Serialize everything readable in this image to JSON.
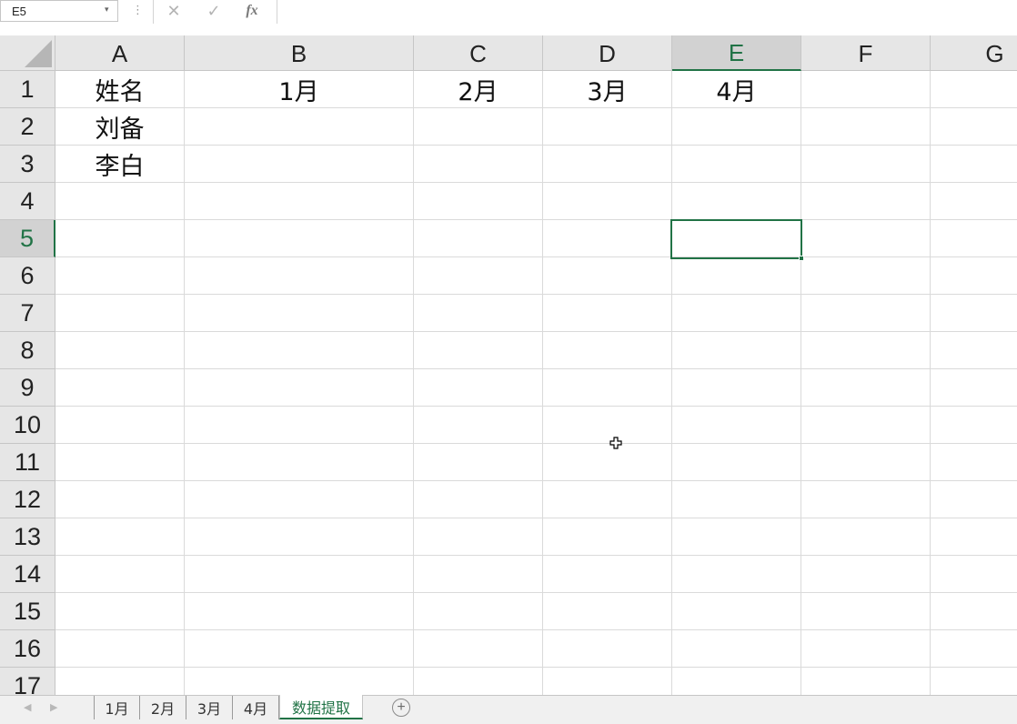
{
  "formula_bar": {
    "name_box": "E5",
    "name_box_arrow": "▾",
    "separator": "⋮",
    "cancel_icon": "✕",
    "enter_icon": "✓",
    "fx_label": "fx",
    "formula": ""
  },
  "columns": [
    "A",
    "B",
    "C",
    "D",
    "E",
    "F",
    "G"
  ],
  "rows": [
    "1",
    "2",
    "3",
    "4",
    "5",
    "6",
    "7",
    "8",
    "9",
    "10",
    "11",
    "12",
    "13",
    "14",
    "15",
    "16",
    "17"
  ],
  "active_cell": "E5",
  "cells": {
    "A1": "姓名",
    "B1": "1月",
    "C1": "2月",
    "D1": "3月",
    "E1": "4月",
    "A2": "刘备",
    "A3": "李白"
  },
  "sheet_tabs": [
    {
      "label": "1月",
      "active": false
    },
    {
      "label": "2月",
      "active": false
    },
    {
      "label": "3月",
      "active": false
    },
    {
      "label": "4月",
      "active": false
    },
    {
      "label": "数据提取",
      "active": true
    }
  ],
  "tab_nav": {
    "prev": "◀",
    "next": "▶"
  },
  "add_sheet_label": "+",
  "colors": {
    "accent": "#217346",
    "header_bg": "#e6e6e6",
    "header_active_bg": "#d2d2d2",
    "gridline": "#dadada"
  },
  "icons": {
    "cancel": "close-icon",
    "enter": "check-icon",
    "function": "fx-icon",
    "cursor": "cell-select-cursor-icon",
    "add_sheet": "plus-circle-icon"
  }
}
